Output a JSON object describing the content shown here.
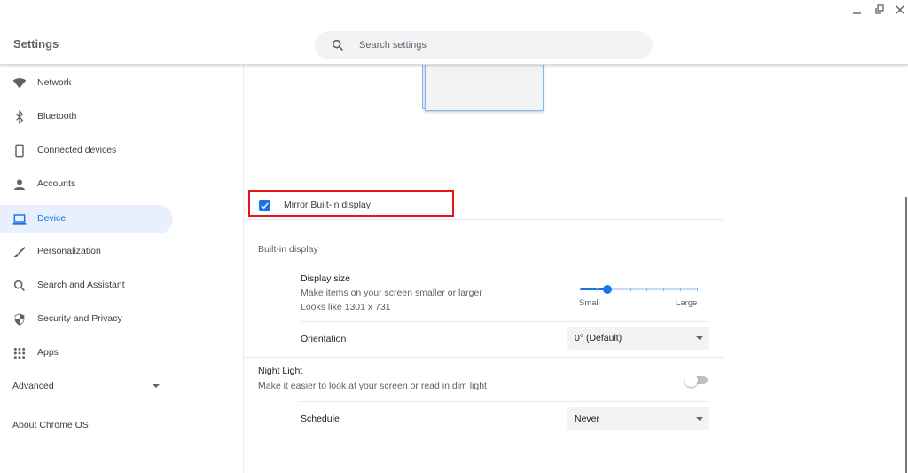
{
  "window": {
    "title": "Settings",
    "controls": {
      "minimize": "minimize-icon",
      "restore": "restore-icon",
      "close": "close-icon"
    }
  },
  "search": {
    "placeholder": "Search settings",
    "value": "",
    "icon": "search-icon"
  },
  "sidebar": {
    "items": [
      {
        "label": "Network",
        "icon": "wifi-icon",
        "active": false
      },
      {
        "label": "Bluetooth",
        "icon": "bluetooth-icon",
        "active": false
      },
      {
        "label": "Connected devices",
        "icon": "phone-icon",
        "active": false
      },
      {
        "label": "Accounts",
        "icon": "person-icon",
        "active": false
      },
      {
        "label": "Device",
        "icon": "laptop-icon",
        "active": true
      },
      {
        "label": "Personalization",
        "icon": "brush-icon",
        "active": false
      },
      {
        "label": "Search and Assistant",
        "icon": "search-icon",
        "active": false
      },
      {
        "label": "Security and Privacy",
        "icon": "shield-icon",
        "active": false
      },
      {
        "label": "Apps",
        "icon": "apps-grid-icon",
        "active": false
      }
    ],
    "advanced": {
      "label": "Advanced",
      "expanded": false
    },
    "about": "About Chrome OS"
  },
  "main": {
    "mirror": {
      "label": "Mirror Built-in display",
      "checked": true
    },
    "builtin_section": "Built-in display",
    "display_size": {
      "title": "Display size",
      "description": "Make items on your screen smaller or larger",
      "looks_like": "Looks like 1301 x 731",
      "min_label": "Small",
      "max_label": "Large",
      "steps": 8,
      "value_step": 2
    },
    "orientation": {
      "title": "Orientation",
      "value": "0° (Default)"
    },
    "night_light": {
      "title": "Night Light",
      "description": "Make it easier to look at your screen or read in dim light",
      "enabled": false
    },
    "schedule": {
      "title": "Schedule",
      "value": "Never"
    }
  },
  "colors": {
    "accent": "#1a73e8",
    "highlight": "#e8f0fe",
    "annotation": "#e5141b"
  }
}
